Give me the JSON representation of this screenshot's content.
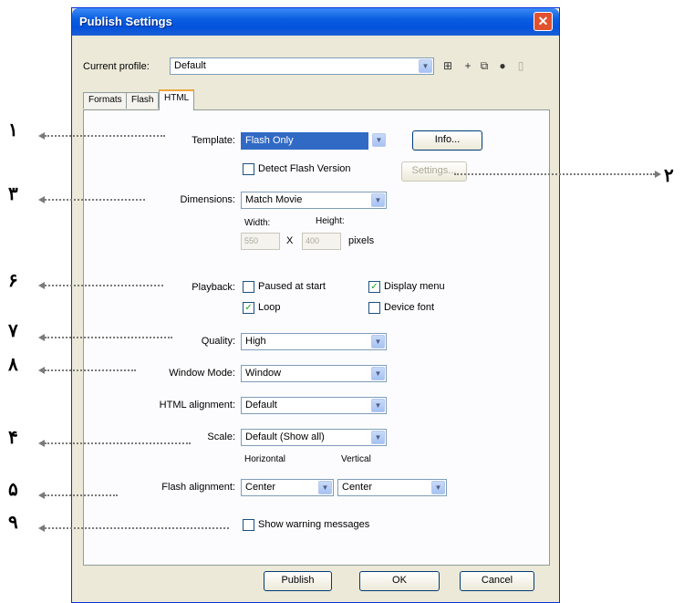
{
  "window": {
    "title": "Publish Settings",
    "close_glyph": "✕"
  },
  "profile": {
    "label": "Current profile:",
    "value": "Default"
  },
  "toolbar": {
    "icons": [
      "profile-menu-icon",
      "add-profile-icon",
      "duplicate-profile-icon",
      "info-icon",
      "delete-profile-icon"
    ]
  },
  "tabs": [
    {
      "label": "Formats"
    },
    {
      "label": "Flash"
    },
    {
      "label": "HTML"
    }
  ],
  "html_tab": {
    "template": {
      "label": "Template:",
      "value": "Flash Only",
      "info_button": "Info..."
    },
    "detect_version": {
      "label": "Detect Flash Version",
      "checked": false,
      "settings_button": "Settings..."
    },
    "dimensions": {
      "label": "Dimensions:",
      "value": "Match Movie",
      "width_label": "Width:",
      "height_label": "Height:",
      "width_value": "550",
      "height_value": "400",
      "times": "X",
      "unit": "pixels"
    },
    "playback": {
      "label": "Playback:",
      "paused": {
        "label": "Paused at start",
        "checked": false
      },
      "display_menu": {
        "label": "Display menu",
        "checked": true
      },
      "loop": {
        "label": "Loop",
        "checked": true
      },
      "device_font": {
        "label": "Device font",
        "checked": false
      }
    },
    "quality": {
      "label": "Quality:",
      "value": "High"
    },
    "window_mode": {
      "label": "Window Mode:",
      "value": "Window"
    },
    "html_alignment": {
      "label": "HTML alignment:",
      "value": "Default"
    },
    "scale": {
      "label": "Scale:",
      "value": "Default (Show all)"
    },
    "flash_alignment": {
      "label": "Flash alignment:",
      "horizontal_label": "Horizontal",
      "horizontal_value": "Center",
      "vertical_label": "Vertical",
      "vertical_value": "Center"
    },
    "warnings": {
      "label": "Show warning messages",
      "checked": false
    }
  },
  "buttons": {
    "publish": "Publish",
    "ok": "OK",
    "cancel": "Cancel"
  },
  "annotations": {
    "n1": "۱",
    "n2": "۲",
    "n3": "۳",
    "n6": "۶",
    "n7": "۷",
    "n8": "۸",
    "n4": "۴",
    "n5": "۵",
    "n9": "۹"
  },
  "colors": {
    "titlebar": "#0a5ee0",
    "dialog_bg": "#ece9d8",
    "selection": "#316ac5",
    "annotation": "#7a7a7a"
  }
}
